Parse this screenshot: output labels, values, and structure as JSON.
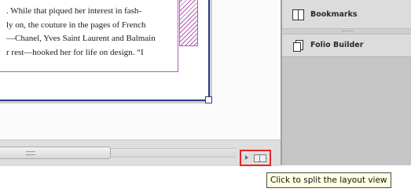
{
  "document": {
    "text_lines": [
      ". While that piqued her interest in fash-",
      "ly on, the couture in the pages of French",
      "—Chanel, Yves Saint Laurent and Balmain",
      "r rest—hooked her for life on design. “I"
    ]
  },
  "panel": {
    "items": [
      {
        "label": "Bookmarks",
        "icon": "bookmarks-icon"
      },
      {
        "label": "Folio Builder",
        "icon": "folio-builder-icon"
      }
    ]
  },
  "status_bar": {
    "split_button_icon": "split-layout-icon",
    "highlight_color": "#e32626"
  },
  "tooltip": {
    "text": "Click to split the layout view"
  }
}
